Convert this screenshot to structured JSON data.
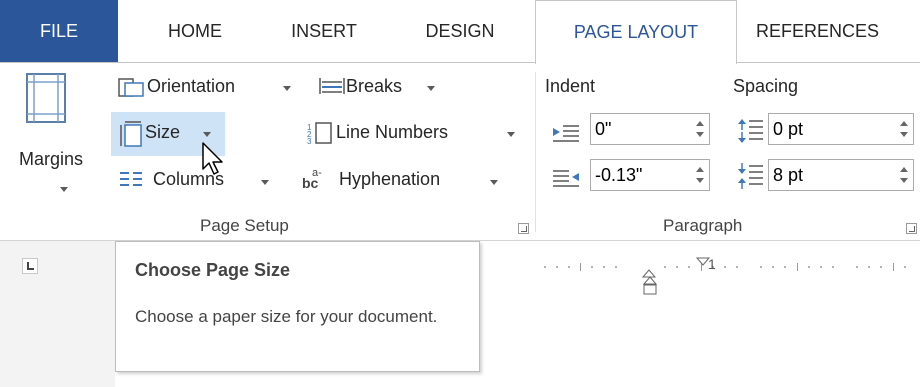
{
  "tabs": {
    "file": "FILE",
    "home": "HOME",
    "insert": "INSERT",
    "design": "DESIGN",
    "page_layout": "PAGE LAYOUT",
    "references": "REFERENCES"
  },
  "page_setup": {
    "margins": "Margins",
    "orientation": "Orientation",
    "size": "Size",
    "columns": "Columns",
    "breaks": "Breaks",
    "line_numbers": "Line Numbers",
    "hyphenation": "Hyphenation",
    "group_label": "Page Setup"
  },
  "paragraph": {
    "indent_label": "Indent",
    "spacing_label": "Spacing",
    "indent_left": "0\"",
    "indent_right": "-0.13\"",
    "spacing_before": "0 pt",
    "spacing_after": "8 pt",
    "group_label": "Paragraph"
  },
  "ruler": {
    "mark_1": "1"
  },
  "tooltip": {
    "title": "Choose Page Size",
    "body": "Choose a paper size for your document."
  },
  "colors": {
    "file_tab": "#2b579a",
    "active_tab_text": "#2b579a",
    "hover_highlight": "#cfe3f6"
  }
}
